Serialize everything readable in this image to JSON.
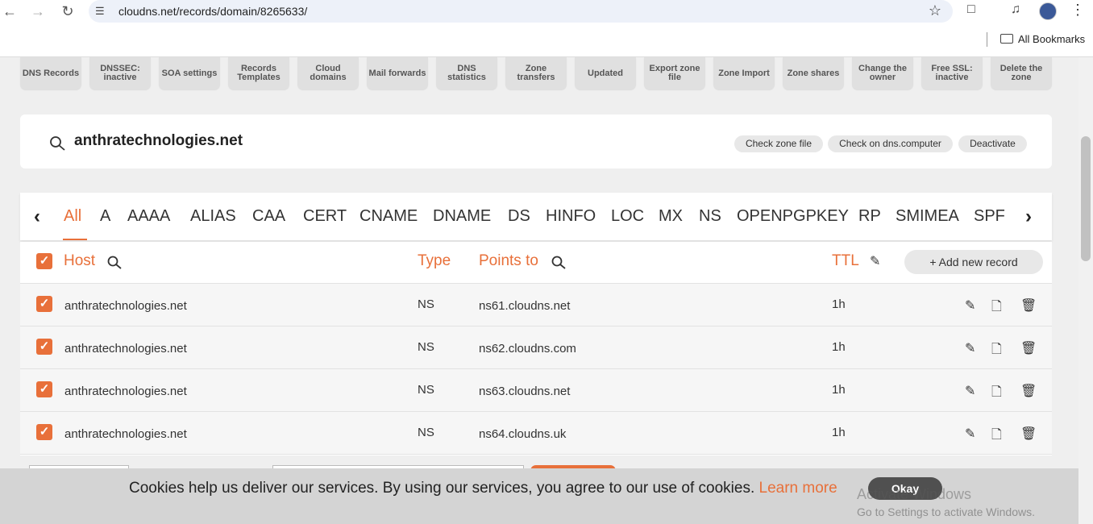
{
  "browser": {
    "url": "cloudns.net/records/domain/8265633/",
    "bookmarks_label": "All Bookmarks"
  },
  "toolbar": {
    "tiles": [
      "DNS Records",
      "DNSSEC: inactive",
      "SOA settings",
      "Records Templates",
      "Cloud domains",
      "Mail forwards",
      "DNS statistics",
      "Zone transfers",
      "Updated",
      "Export zone file",
      "Zone Import",
      "Zone shares",
      "Change the owner",
      "Free SSL: inactive",
      "Delete the zone"
    ]
  },
  "domain": {
    "name": "anthratechnologies.net",
    "actions": [
      "Check zone file",
      "Check on dns.computer",
      "Deactivate"
    ]
  },
  "tabs": [
    "All",
    "A",
    "AAAA",
    "ALIAS",
    "CAA",
    "CERT",
    "CNAME",
    "DNAME",
    "DS",
    "HINFO",
    "LOC",
    "MX",
    "NS",
    "OPENPGPKEY",
    "RP",
    "SMIMEA",
    "SPF"
  ],
  "active_tab": "All",
  "table": {
    "headers": {
      "host": "Host",
      "type": "Type",
      "points_to": "Points to",
      "ttl": "TTL"
    },
    "add_label": "+ Add new record",
    "rows": [
      {
        "host": "anthratechnologies.net",
        "type": "NS",
        "points_to": "ns61.cloudns.net",
        "ttl": "1h"
      },
      {
        "host": "anthratechnologies.net",
        "type": "NS",
        "points_to": "ns62.cloudns.com",
        "ttl": "1h"
      },
      {
        "host": "anthratechnologies.net",
        "type": "NS",
        "points_to": "ns63.cloudns.net",
        "ttl": "1h"
      },
      {
        "host": "anthratechnologies.net",
        "type": "NS",
        "points_to": "ns64.cloudns.uk",
        "ttl": "1h"
      }
    ]
  },
  "cookie": {
    "message": "Cookies help us deliver our services. By using our services, you agree to our use of cookies.",
    "link": "Learn more",
    "button": "Okay"
  },
  "watermark": {
    "title": "Activate Windows",
    "subtitle": "Go to Settings to activate Windows."
  },
  "colors": {
    "accent": "#e8703a"
  }
}
